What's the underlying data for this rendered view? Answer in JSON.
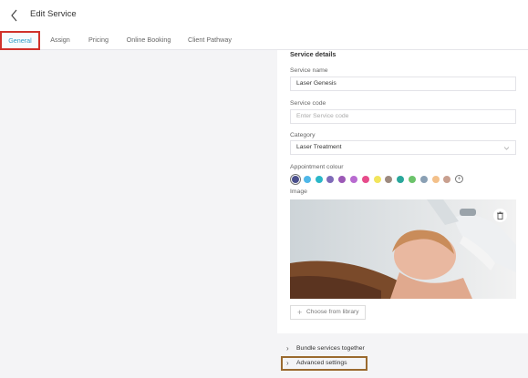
{
  "header": {
    "title": "Edit Service",
    "back_icon": "chevron-left-icon"
  },
  "tabs": [
    {
      "label": "General",
      "active": true
    },
    {
      "label": "Assign",
      "active": false
    },
    {
      "label": "Pricing",
      "active": false
    },
    {
      "label": "Online Booking",
      "active": false
    },
    {
      "label": "Client Pathway",
      "active": false
    }
  ],
  "form": {
    "section_title": "Service details",
    "service_name": {
      "label": "Service name",
      "value": "Laser Genesis"
    },
    "service_code": {
      "label": "Service code",
      "placeholder": "Enter Service code"
    },
    "category": {
      "label": "Category",
      "value": "Laser Treatment"
    },
    "appointment_colour": {
      "label": "Appointment colour",
      "colors": [
        "#4a4f8c",
        "#4fb7e8",
        "#2bb7c8",
        "#7f6bb8",
        "#9b59b6",
        "#b86bd0",
        "#e74c8b",
        "#f2e55c",
        "#9d8a7f",
        "#2aa79b",
        "#6cc36b",
        "#8aa0b4",
        "#f3c08a",
        "#c9a08f"
      ],
      "selected_index": 0,
      "add_icon": "plus-circle-icon"
    },
    "image": {
      "label": "Image",
      "delete_icon": "trash-icon"
    },
    "choose_library": {
      "label": "Choose from library",
      "icon": "plus-icon"
    }
  },
  "sections": {
    "bundle": {
      "label": "Bundle services together",
      "icon": "chevron-right-icon"
    },
    "advanced": {
      "label": "Advanced settings",
      "icon": "chevron-right-icon"
    }
  },
  "colors": {
    "accent": "#2f9ec8",
    "highlight": "#d0322b",
    "advanced_outline": "#9a6a2f"
  }
}
